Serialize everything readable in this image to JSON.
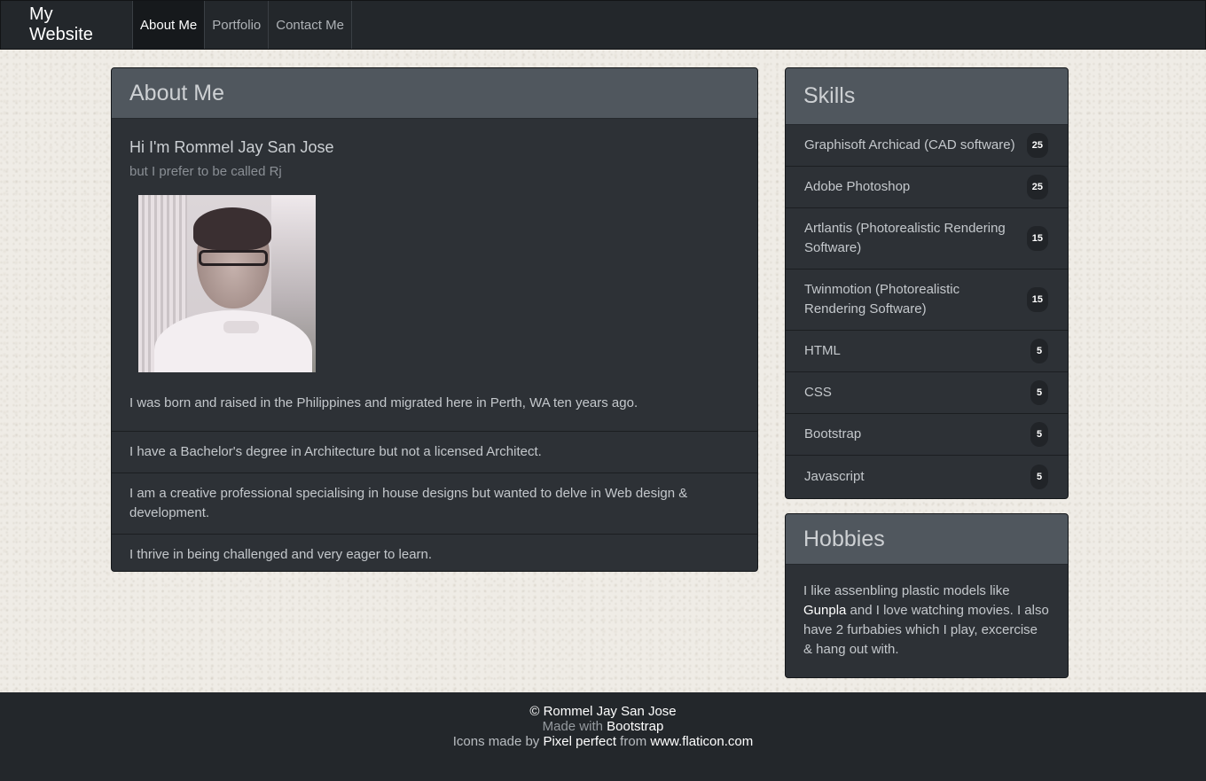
{
  "nav": {
    "brand": "My Website",
    "items": [
      {
        "label": "About Me"
      },
      {
        "label": "Portfolio"
      },
      {
        "label": "Contact Me"
      }
    ]
  },
  "about": {
    "title": "About Me",
    "greeting": "Hi I'm Rommel Jay San Jose",
    "subtitle": "but I prefer to be called Rj",
    "intro": "I was born and raised in the Philippines and migrated here in Perth, WA ten years ago.",
    "list": [
      "I have a Bachelor's degree in Architecture but not a licensed Architect.",
      "I am a creative professional specialising in house designs but wanted to delve in Web design & development.",
      "I thrive in being challenged and very eager to learn."
    ]
  },
  "skills": {
    "title": "Skills",
    "items": [
      {
        "name": "Graphisoft Archicad (CAD software)",
        "count": "25"
      },
      {
        "name": "Adobe Photoshop",
        "count": "25"
      },
      {
        "name": "Artlantis (Photorealistic Rendering Software)",
        "count": "15"
      },
      {
        "name": "Twinmotion (Photorealistic Rendering Software)",
        "count": "15"
      },
      {
        "name": "HTML",
        "count": "5"
      },
      {
        "name": "CSS",
        "count": "5"
      },
      {
        "name": "Bootstrap",
        "count": "5"
      },
      {
        "name": "Javascript",
        "count": "5"
      }
    ]
  },
  "hobbies": {
    "title": "Hobbies",
    "text_before": "I like assenbling plastic models like ",
    "link": "Gunpla",
    "text_after": " and I love watching movies. I also have 2 furbabies which I play, excercise & hang out with."
  },
  "footer": {
    "copyright": "© Rommel Jay San Jose",
    "made_with": "Made with ",
    "made_with_link": "Bootstrap",
    "icons_by": "Icons made by ",
    "icons_author": "Pixel perfect",
    "icons_from": " from ",
    "icons_site": "www.flaticon.com"
  }
}
